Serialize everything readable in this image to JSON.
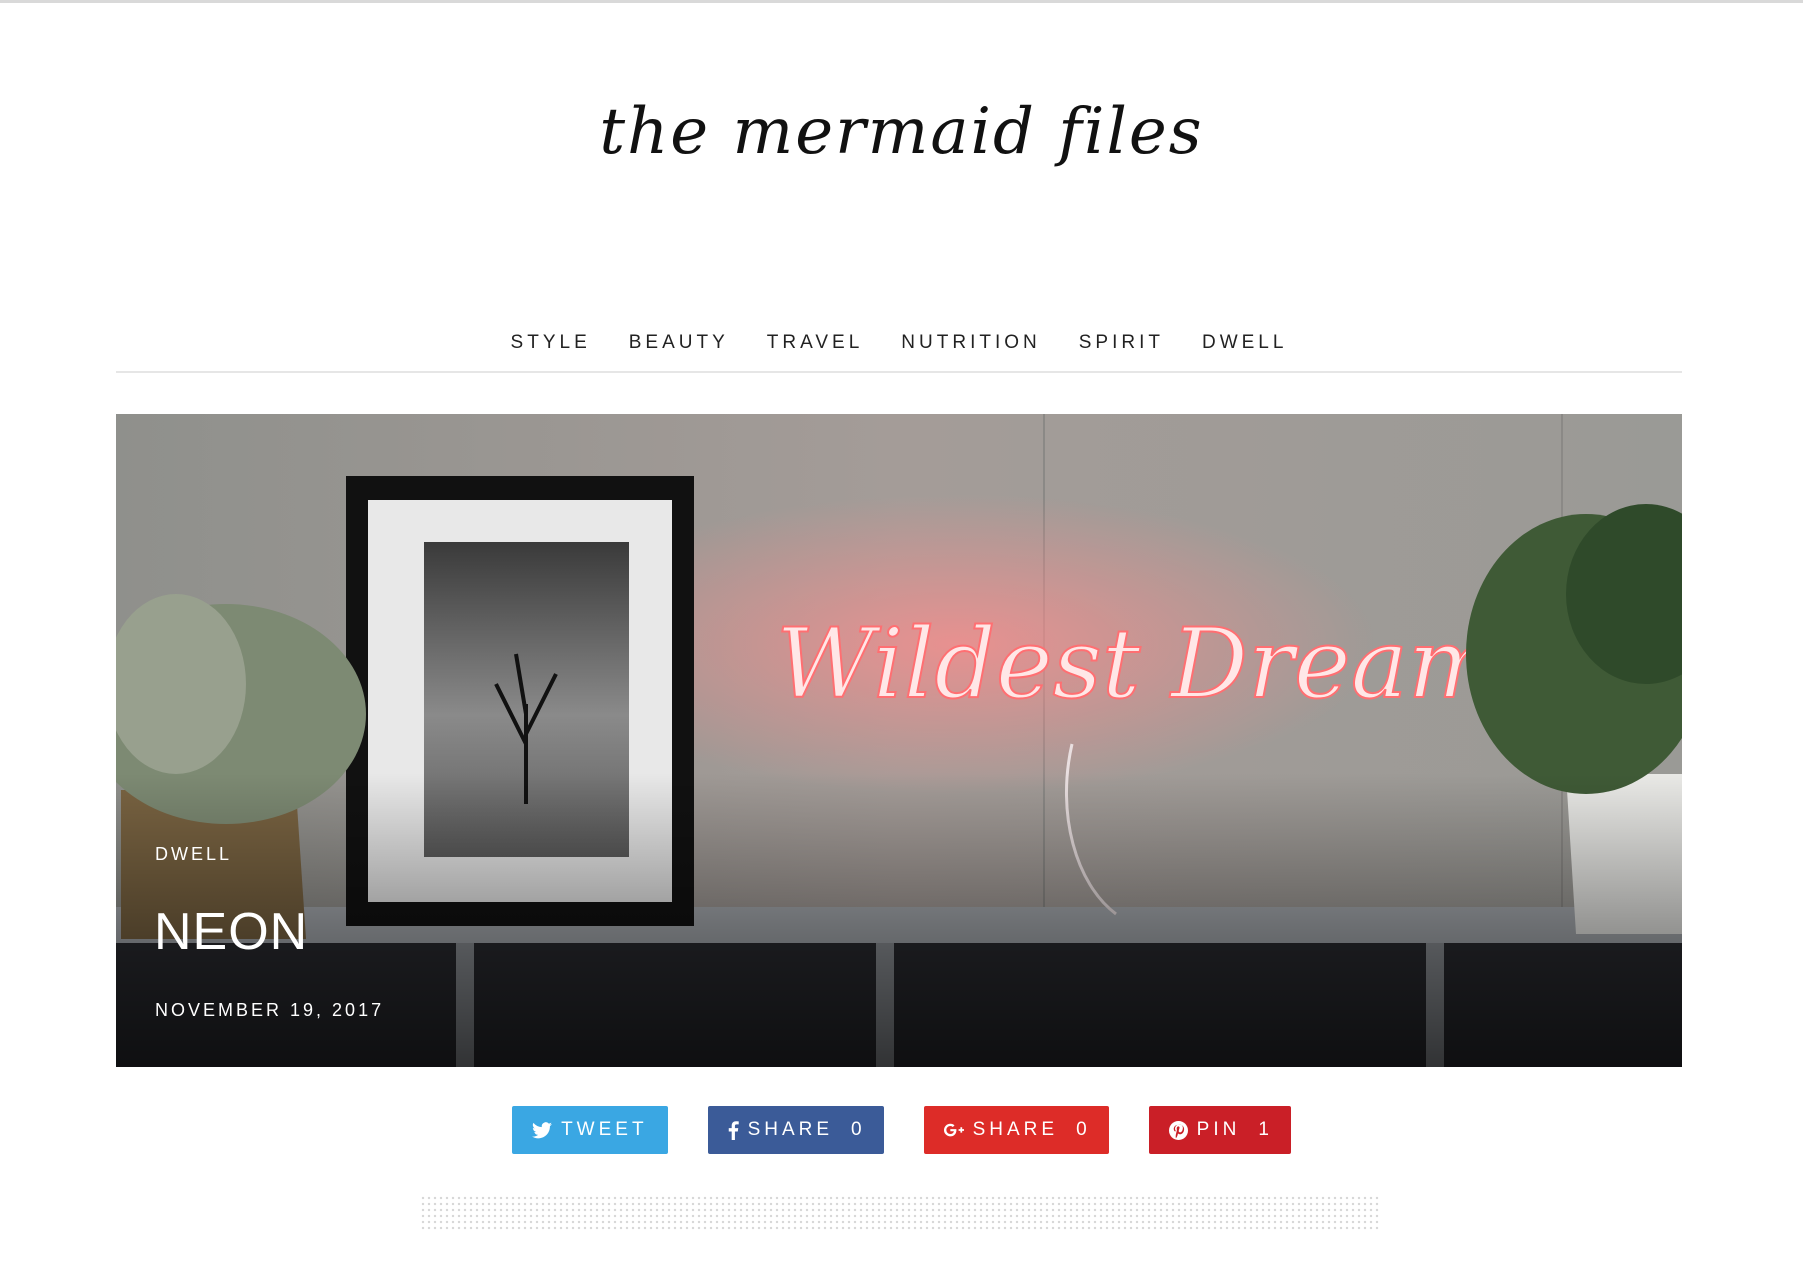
{
  "site": {
    "logo_text": "the mermaid files"
  },
  "nav": {
    "items": [
      {
        "label": "STYLE"
      },
      {
        "label": "BEAUTY"
      },
      {
        "label": "TRAVEL"
      },
      {
        "label": "NUTRITION"
      },
      {
        "label": "SPIRIT"
      },
      {
        "label": "DWELL"
      }
    ]
  },
  "featured_post": {
    "category": "DWELL",
    "title": "NEON",
    "date": "NOVEMBER 19, 2017",
    "image_sign_text": "Wildest Dreams"
  },
  "share_buttons": [
    {
      "label": "TWEET",
      "count": "",
      "icon": "twitter-icon",
      "color": "#3aa7e3"
    },
    {
      "label": "SHARE",
      "count": "0",
      "icon": "facebook-icon",
      "color": "#3b5b98"
    },
    {
      "label": "SHARE",
      "count": "0",
      "icon": "google-plus-icon",
      "color": "#dd2c28"
    },
    {
      "label": "PIN",
      "count": "1",
      "icon": "pinterest-icon",
      "color": "#ca1f27"
    }
  ]
}
